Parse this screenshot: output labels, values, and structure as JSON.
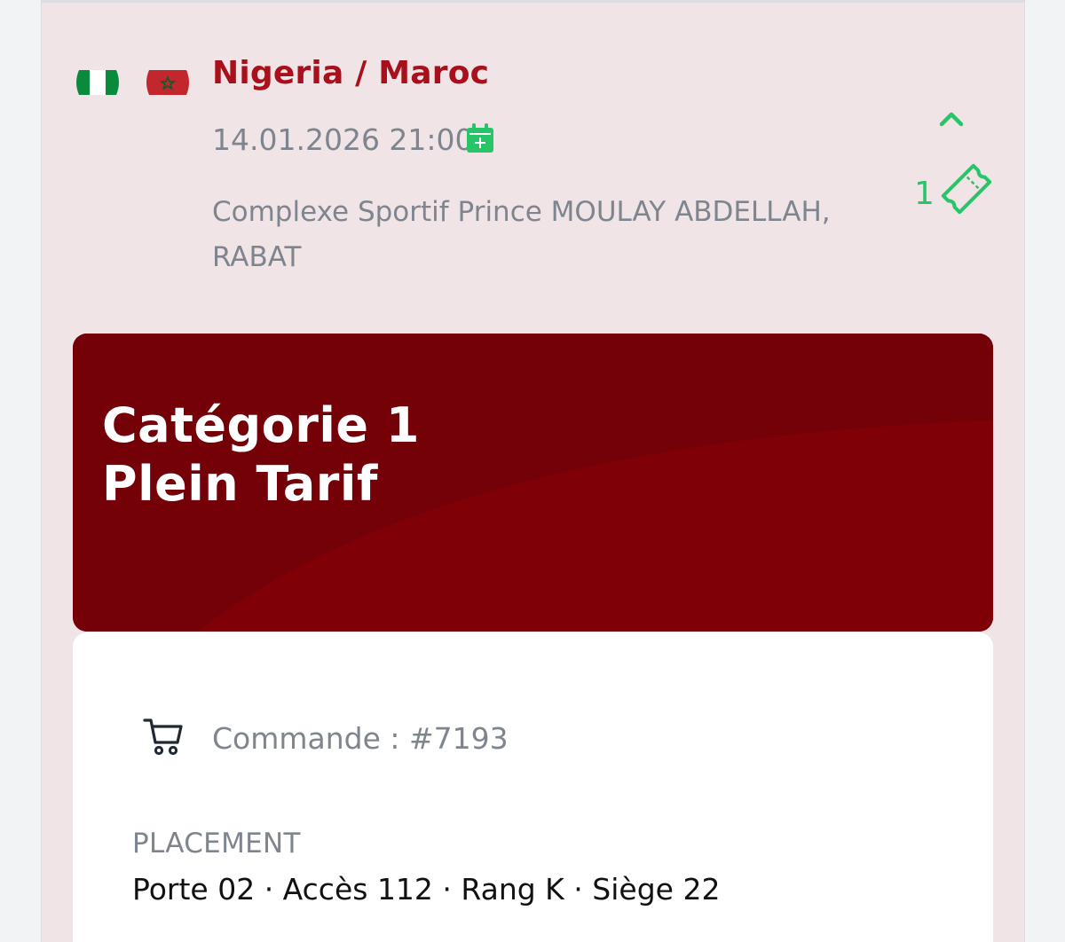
{
  "match": {
    "title": "Nigeria / Maroc",
    "datetime": "14.01.2026 21:00",
    "venue": "Complexe Sportif Prince MOULAY ABDELLAH, RABAT",
    "ticket_count": "1"
  },
  "category": {
    "line1": "Catégorie 1",
    "line2": "Plein Tarif"
  },
  "order": {
    "label": "Commande : #7193"
  },
  "placement": {
    "label": "PLACEMENT",
    "value": "Porte 02 · Accès 112 · Rang K · Siège 22"
  },
  "icons": {
    "flag_home": "nigeria-flag-icon",
    "flag_away": "morocco-flag-icon",
    "calendar": "calendar-add-icon",
    "collapse": "chevron-up-icon",
    "ticket": "ticket-icon",
    "cart": "cart-icon"
  },
  "colors": {
    "title_red": "#a8101c",
    "banner_dark_red": "#740008",
    "banner_red": "#7f0007",
    "accent_green": "#27c468",
    "card_bg": "#f1e4e6",
    "muted_text": "#7f858f"
  }
}
